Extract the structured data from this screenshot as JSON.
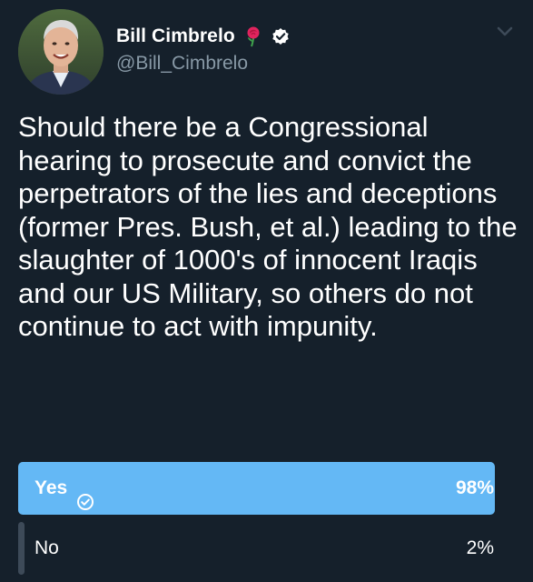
{
  "author": {
    "display_name": "Bill Cimbrelo",
    "handle": "@Bill_Cimbrelo",
    "icons": [
      "rose-icon",
      "verified-icon"
    ]
  },
  "tweet": {
    "text": "Should there be a Congressional hearing to prosecute and convict the perpetrators of the lies and deceptions (former Pres. Bush, et al.) leading to the slaughter of 1000's of innocent Iraqis and our US Military, so others do not continue to act with impunity."
  },
  "poll": {
    "options": [
      {
        "label": "Yes",
        "percent_label": "98%",
        "percent": 98,
        "selected": true
      },
      {
        "label": "No",
        "percent_label": "2%",
        "percent": 2,
        "selected": false
      }
    ]
  },
  "colors": {
    "background": "#15202b",
    "winning_bar": "#64b8f5",
    "losing_bar": "#3d4a58",
    "handle": "#8899a6"
  }
}
